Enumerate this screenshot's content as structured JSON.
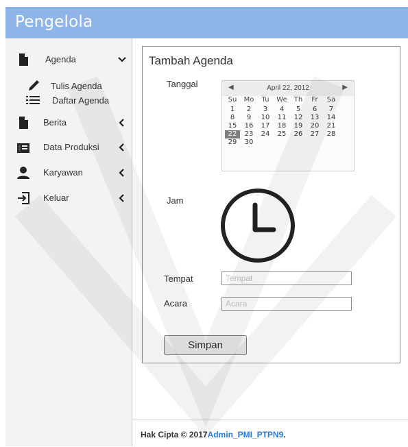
{
  "header": {
    "title": "Pengelola"
  },
  "sidebar": {
    "agenda": {
      "label": "Agenda",
      "icon": "document-icon"
    },
    "tulis": {
      "label": "Tulis Agenda",
      "icon": "pencil-icon"
    },
    "daftar": {
      "label": "Daftar Agenda",
      "icon": "list-icon"
    },
    "berita": {
      "label": "Berita",
      "icon": "document-icon"
    },
    "produk": {
      "label": "Data Produksi",
      "icon": "database-icon"
    },
    "karyawan": {
      "label": "Karyawan",
      "icon": "user-icon"
    },
    "keluar": {
      "label": "Keluar",
      "icon": "logout-icon"
    }
  },
  "panel": {
    "title": "Tambah Agenda",
    "tanggal_label": "Tanggal",
    "jam_label": "Jam",
    "tempat_label": "Tempat",
    "acara_label": "Acara",
    "tempat_placeholder": "Tempat",
    "acara_placeholder": "Acara",
    "save_label": "Simpan"
  },
  "calendar": {
    "month_label": "April 22, 2012",
    "weekdays": [
      "Su",
      "Mo",
      "Tu",
      "We",
      "Th",
      "Fr",
      "Sa"
    ],
    "weeks": [
      [
        "1",
        "2",
        "3",
        "4",
        "5",
        "6",
        "7"
      ],
      [
        "8",
        "9",
        "10",
        "11",
        "12",
        "13",
        "14"
      ],
      [
        "15",
        "16",
        "17",
        "18",
        "19",
        "20",
        "21"
      ],
      [
        "22",
        "23",
        "24",
        "25",
        "26",
        "27",
        "28"
      ],
      [
        "29",
        "30",
        "",
        "",
        "",
        "",
        ""
      ]
    ],
    "selected": "22"
  },
  "footer": {
    "prefix": "Hak Cipta © 2017",
    "link": "Admin_PMI_PTPN9",
    "suffix": "."
  }
}
